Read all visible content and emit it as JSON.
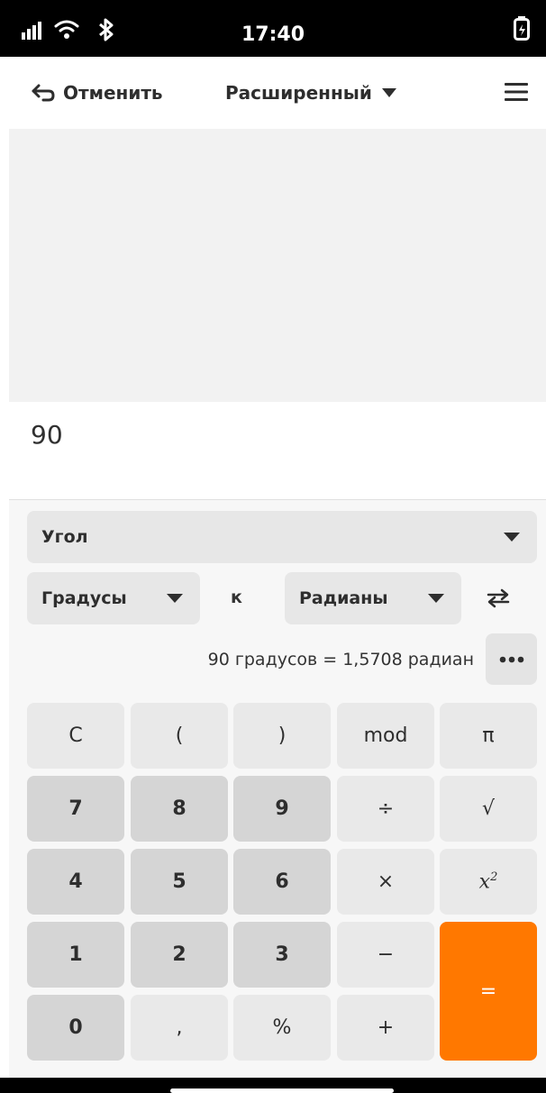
{
  "status_bar": {
    "time": "17:40",
    "icons": [
      "signal-icon",
      "wifi-icon",
      "bluetooth-icon",
      "battery-charging-icon"
    ]
  },
  "header": {
    "undo_label": "Отменить",
    "mode_label": "Расширенный",
    "icons": [
      "undo-arrow-icon",
      "caret-down-icon",
      "menu-icon"
    ]
  },
  "display": {
    "value": "90"
  },
  "converter": {
    "category": "Угол",
    "from_unit": "Градусы",
    "to_word": "к",
    "to_unit": "Радианы",
    "result": "90 градусов  =  1,5708 радиан",
    "icons": [
      "swap-icon",
      "more-icon"
    ]
  },
  "keypad": {
    "row1": [
      "C",
      "(",
      ")",
      "mod",
      "π"
    ],
    "row2": [
      "7",
      "8",
      "9",
      "÷",
      "√"
    ],
    "row3": [
      "4",
      "5",
      "6",
      "×",
      "x2"
    ],
    "row4": [
      "1",
      "2",
      "3",
      "−"
    ],
    "row5": [
      "0",
      ",",
      "%",
      "+"
    ],
    "equals": "="
  },
  "colors": {
    "accent": "#ff7800",
    "number_key": "#d5d5d5",
    "function_key": "#e9e9e9"
  }
}
